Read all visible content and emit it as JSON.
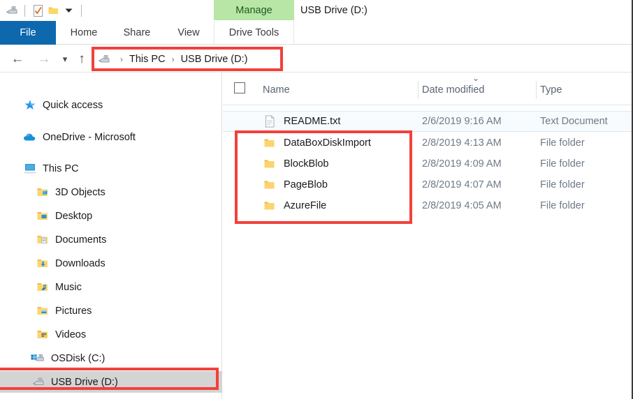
{
  "window": {
    "title": "USB Drive (D:)",
    "accent_blue": "#0d68ae",
    "contextual_green": "#b8e6a6",
    "annotation_red": "#f2413c",
    "selection_grey": "#d4d4d4"
  },
  "quick_access_toolbar": {
    "items": [
      {
        "name": "usb-drive-icon",
        "label": "USB Drive"
      },
      {
        "name": "properties-icon",
        "label": "Properties"
      },
      {
        "name": "new-folder-icon",
        "label": "New folder"
      },
      {
        "name": "customize-chevron-icon",
        "label": "Customize Quick Access Toolbar"
      }
    ]
  },
  "ribbon": {
    "contextual_group_label": "Manage",
    "tabs": [
      {
        "id": "file",
        "label": "File"
      },
      {
        "id": "home",
        "label": "Home"
      },
      {
        "id": "share",
        "label": "Share"
      },
      {
        "id": "view",
        "label": "View"
      },
      {
        "id": "drive-tools",
        "label": "Drive Tools"
      }
    ]
  },
  "address_bar": {
    "back_label": "Back",
    "forward_label": "Forward",
    "recent_label": "Recent locations",
    "up_label": "Up",
    "breadcrumbs": [
      {
        "label": "This PC"
      },
      {
        "label": "USB Drive (D:)"
      }
    ],
    "separator": "›"
  },
  "nav_pane": {
    "items": [
      {
        "label": "Quick access",
        "icon": "star-icon",
        "indent": 0,
        "selected": false
      },
      {
        "label": "OneDrive - Microsoft",
        "icon": "cloud-icon",
        "indent": 0,
        "selected": false
      },
      {
        "label": "This PC",
        "icon": "computer-icon",
        "indent": 0,
        "selected": false
      },
      {
        "label": "3D Objects",
        "icon": "folder-3d-icon",
        "indent": 1,
        "selected": false
      },
      {
        "label": "Desktop",
        "icon": "folder-desktop-icon",
        "indent": 1,
        "selected": false
      },
      {
        "label": "Documents",
        "icon": "folder-documents-icon",
        "indent": 1,
        "selected": false
      },
      {
        "label": "Downloads",
        "icon": "folder-downloads-icon",
        "indent": 1,
        "selected": false
      },
      {
        "label": "Music",
        "icon": "folder-music-icon",
        "indent": 1,
        "selected": false
      },
      {
        "label": "Pictures",
        "icon": "folder-pictures-icon",
        "indent": 1,
        "selected": false
      },
      {
        "label": "Videos",
        "icon": "folder-videos-icon",
        "indent": 1,
        "selected": false
      },
      {
        "label": "OSDisk (C:)",
        "icon": "windows-drive-icon",
        "indent": 1,
        "selected": false
      },
      {
        "label": "USB Drive (D:)",
        "icon": "usb-drive-icon",
        "indent": 1,
        "selected": true
      }
    ]
  },
  "file_list": {
    "columns": [
      {
        "id": "name",
        "label": "Name",
        "sorted": false
      },
      {
        "id": "date",
        "label": "Date modified",
        "sorted": true
      },
      {
        "id": "type",
        "label": "Type",
        "sorted": false
      }
    ],
    "sort_indicator": "⌄",
    "select_all_checked": false,
    "rows": [
      {
        "name": "README.txt",
        "date": "2/6/2019 9:16 AM",
        "type": "Text Document",
        "icon": "text-file-icon",
        "hover": true
      },
      {
        "name": "DataBoxDiskImport",
        "date": "2/8/2019 4:13 AM",
        "type": "File folder",
        "icon": "folder-icon",
        "hover": false
      },
      {
        "name": "BlockBlob",
        "date": "2/8/2019 4:09 AM",
        "type": "File folder",
        "icon": "folder-icon",
        "hover": false
      },
      {
        "name": "PageBlob",
        "date": "2/8/2019 4:07 AM",
        "type": "File folder",
        "icon": "folder-icon",
        "hover": false
      },
      {
        "name": "AzureFile",
        "date": "2/8/2019 4:05 AM",
        "type": "File folder",
        "icon": "folder-icon",
        "hover": false
      }
    ]
  },
  "annotations": [
    {
      "id": "address",
      "target": "breadcrumb-path"
    },
    {
      "id": "folders",
      "target": "folder-rows"
    },
    {
      "id": "usb",
      "target": "nav-item-usb-drive"
    }
  ]
}
